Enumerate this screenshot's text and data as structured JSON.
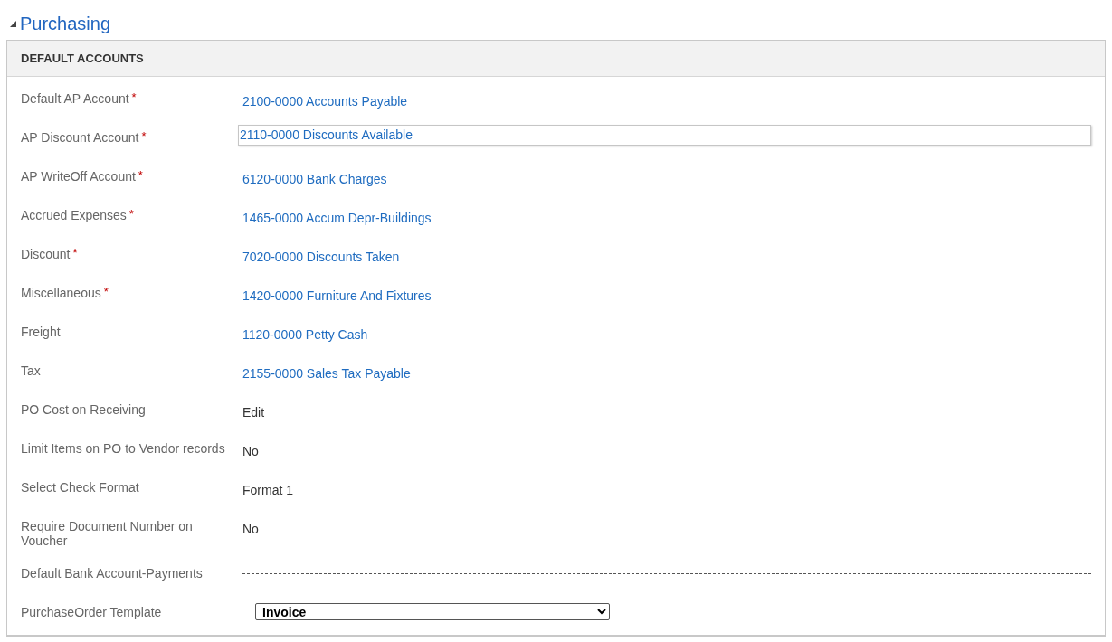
{
  "section": {
    "title": "Purchasing",
    "expanded": true
  },
  "panel": {
    "header": "DEFAULT ACCOUNTS",
    "rows": [
      {
        "label": "Default AP Account",
        "required_mark": "*",
        "kind": "link",
        "value": "2100-0000 Accounts Payable"
      },
      {
        "label": "AP Discount Account",
        "required_mark": "*",
        "kind": "input",
        "value": "2110-0000 Discounts Available"
      },
      {
        "label": "AP WriteOff Account",
        "required_mark": "*",
        "kind": "link",
        "value": "6120-0000 Bank Charges"
      },
      {
        "label": "Accrued Expenses",
        "required_mark": "*",
        "kind": "link",
        "value": "1465-0000 Accum Depr-Buildings"
      },
      {
        "label": "Discount",
        "required_mark": "*",
        "kind": "link",
        "value": "7020-0000 Discounts Taken"
      },
      {
        "label": "Miscellaneous",
        "required_mark": "*",
        "kind": "link",
        "value": "1420-0000 Furniture And Fixtures"
      },
      {
        "label": "Freight",
        "kind": "link",
        "value": "1120-0000 Petty Cash"
      },
      {
        "label": "Tax",
        "kind": "link",
        "value": "2155-0000 Sales Tax Payable"
      },
      {
        "label": "PO Cost on Receiving",
        "kind": "text",
        "value": "Edit"
      },
      {
        "label": "Limit Items on PO to Vendor records",
        "kind": "text",
        "value": "No"
      },
      {
        "label": "Select Check Format",
        "kind": "text",
        "value": "Format 1"
      },
      {
        "label": "Require Document Number on Voucher",
        "kind": "text",
        "value": "No"
      },
      {
        "label": "Default Bank Account-Payments",
        "kind": "empty"
      },
      {
        "label": "PurchaseOrder Template",
        "kind": "select",
        "value": "Invoice"
      }
    ]
  }
}
